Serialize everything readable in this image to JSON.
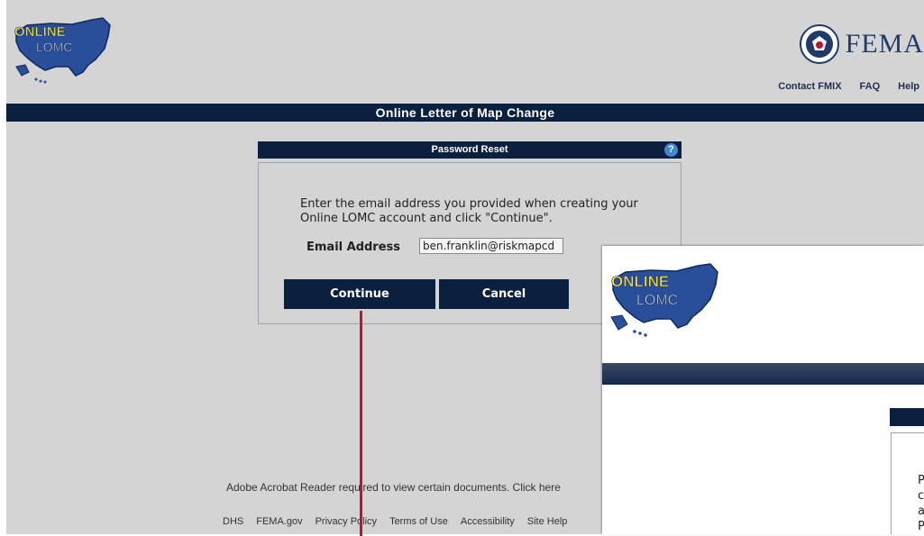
{
  "header": {
    "logo_text_line1": "ONLINE",
    "logo_text_line2": "LOMC",
    "brand": "FEMA",
    "top_links": [
      "Contact FMIX",
      "FAQ",
      "Help"
    ]
  },
  "title_bar": "Online Letter of Map Change",
  "dialog": {
    "title": "Password Reset",
    "help_icon": "?",
    "instruction": "Enter the email address you provided when creating your Online LOMC account and click \"Continue\".",
    "email_label": "Email Address",
    "email_value": "ben.franklin@riskmapcd",
    "continue_label": "Continue",
    "cancel_label": "Cancel"
  },
  "footer": {
    "note": "Adobe Acrobat Reader required to view certain documents.",
    "note_link": "Click here",
    "links": [
      "DHS",
      "FEMA.gov",
      "Privacy Policy",
      "Terms of Use",
      "Accessibility",
      "Site Help"
    ]
  },
  "overlay": {
    "logo_text_line1": "ONLINE",
    "logo_text_line2": "LOMC",
    "partial_letters": [
      "P",
      "c",
      "a",
      "P"
    ]
  },
  "colors": {
    "page_bg": "#d4d4d4",
    "navy": "#0b1f3f",
    "arrow": "#c8102e",
    "logo_text": "#f5e33a",
    "map_blue": "#2a4f9a"
  }
}
